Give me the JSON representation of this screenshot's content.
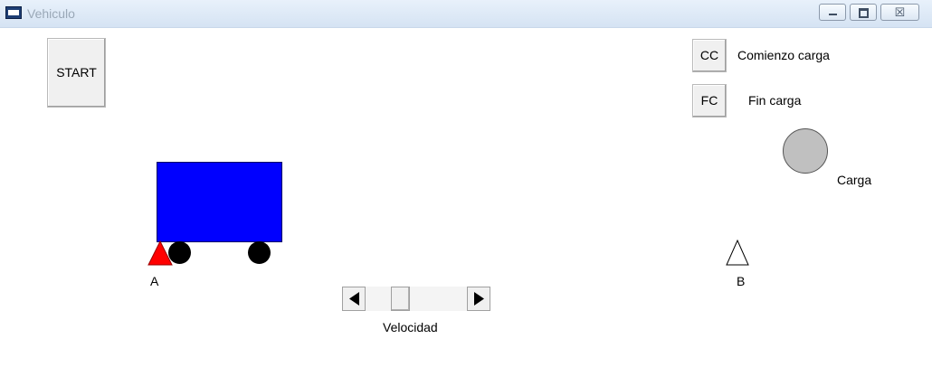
{
  "window": {
    "title": "Vehiculo",
    "close_glyph": "☒"
  },
  "buttons": {
    "start": "START",
    "cc": "CC",
    "fc": "FC"
  },
  "labels": {
    "comienzo": "Comienzo carga",
    "fin": "Fin carga",
    "carga": "Carga",
    "a": "A",
    "b": "B",
    "velocidad": "Velocidad"
  },
  "colors": {
    "truck": "#0000ff",
    "marker_a": "#ff0000",
    "carga_circle": "#c0c0c0"
  },
  "icons": [
    "app-icon",
    "minimize-icon",
    "maximize-icon",
    "close-icon",
    "arrow-left-icon",
    "arrow-right-icon"
  ]
}
